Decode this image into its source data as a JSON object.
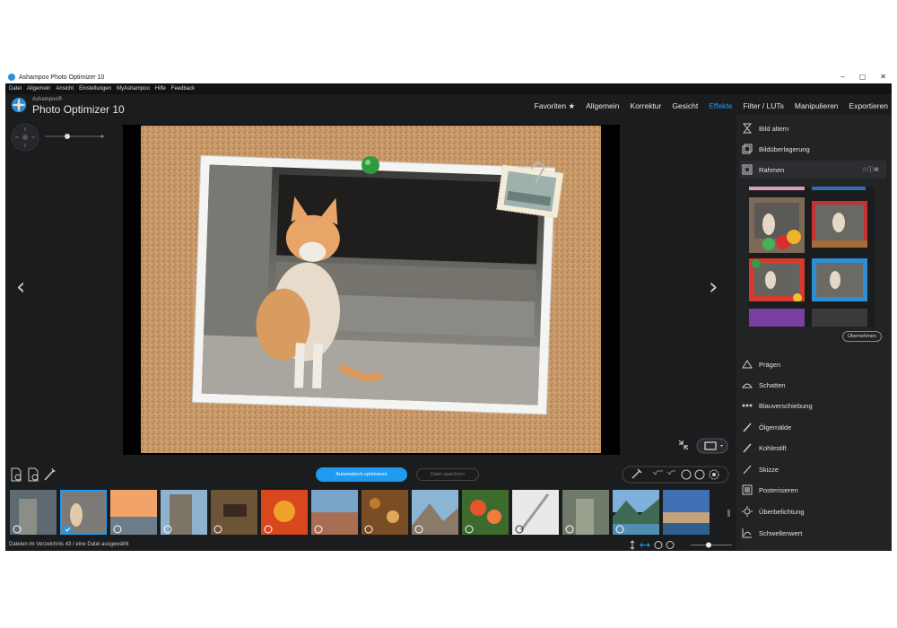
{
  "window": {
    "title": "Ashampoo Photo Optimizer 10",
    "controls": [
      "–",
      "▢",
      "✕"
    ]
  },
  "menu": [
    "Datei",
    "Allgemein",
    "Ansicht",
    "Einstellungen",
    "MyAshampoo",
    "Hilfe",
    "Feedback"
  ],
  "brand": {
    "small": "Ashampoo®",
    "name": "Photo Optimizer 10"
  },
  "tabs": [
    "Favoriten ★",
    "Allgemein",
    "Korrektur",
    "Gesicht",
    "Effekte",
    "Filter / LUTs",
    "Manipulieren",
    "Exportieren"
  ],
  "active_tab": "Effekte",
  "effects_top": [
    "Bild altern",
    "Bildüberlagerung",
    "Rahmen"
  ],
  "frame_rating": "☆ⓘ⊕",
  "apply_label": "Übernehmen",
  "effects_bottom": [
    "Prägen",
    "Schatten",
    "Blauverschiebung",
    "Ölgemälde",
    "Kohlestift",
    "Skizze",
    "Posterisieren",
    "Überbelichtung",
    "Schwellenwert"
  ],
  "buttons": {
    "auto_optimize": "Automatisch optimieren",
    "save_file": "Datei speichern"
  },
  "nav": {
    "prev": "‹",
    "next": "›"
  },
  "status": {
    "text": "Dateien im Verzeichnis 43 / eine Datei ausgewählt"
  },
  "colors": {
    "accent": "#1e9bf0",
    "background": "#1b1c1e",
    "panel": "#222325"
  },
  "icons": [
    "move-icon",
    "undo-icon",
    "redo-icon",
    "rotate-left-icon",
    "rotate-right-icon",
    "settings-icon",
    "compare-icon",
    "shrink-icon",
    "zoom-slider-icon"
  ]
}
